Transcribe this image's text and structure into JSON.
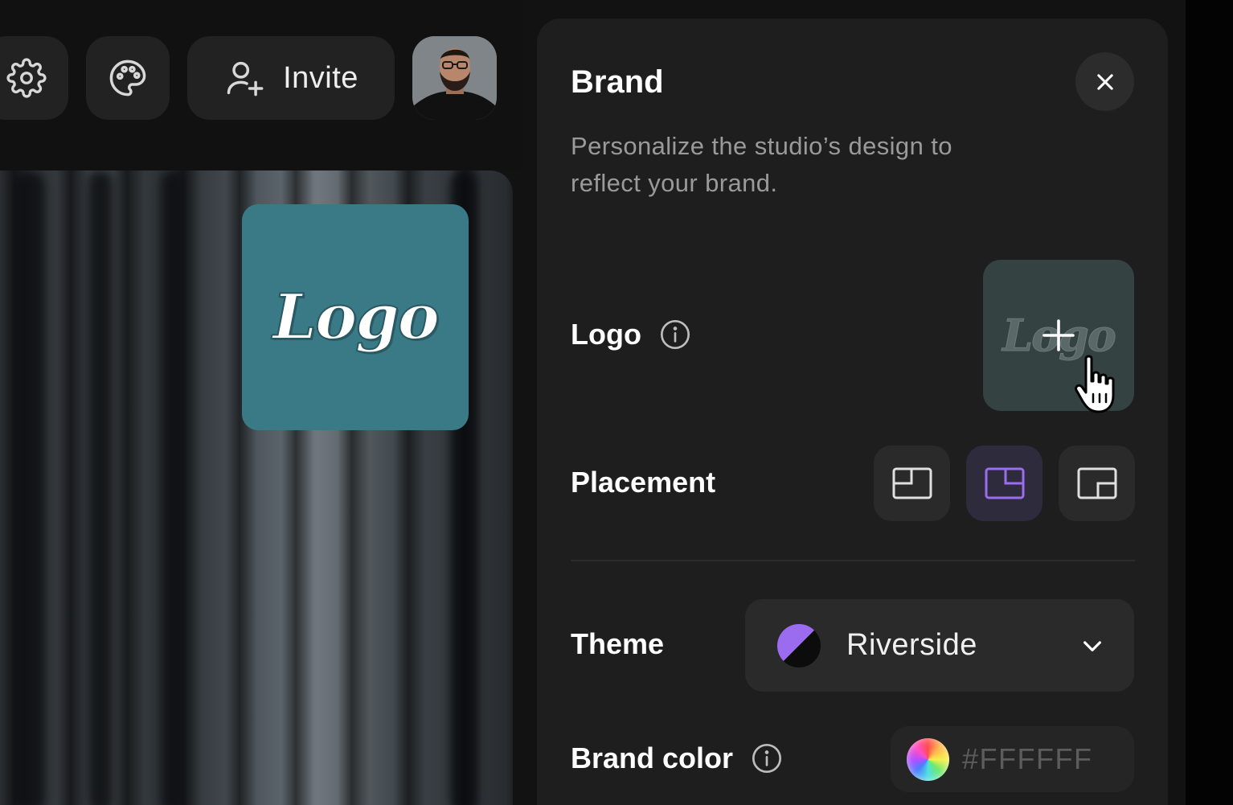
{
  "topbar": {
    "invite_label": "Invite"
  },
  "preview": {
    "logo_text": "Logo"
  },
  "panel": {
    "title": "Brand",
    "description": "Personalize the studio’s design to reflect your brand.",
    "logo_label": "Logo",
    "logo_placeholder_text": "Logo",
    "placement_label": "Placement",
    "placement_options": [
      "top-left",
      "top-right",
      "bottom-right"
    ],
    "placement_selected": "top-right",
    "theme_label": "Theme",
    "theme_value": "Riverside",
    "brand_color_label": "Brand color",
    "brand_color_placeholder": "#FFFFFF"
  },
  "colors": {
    "accent": "#9b6cf0",
    "logo_tile": "#3a7a87",
    "panel_bg": "#1e1e1e"
  }
}
